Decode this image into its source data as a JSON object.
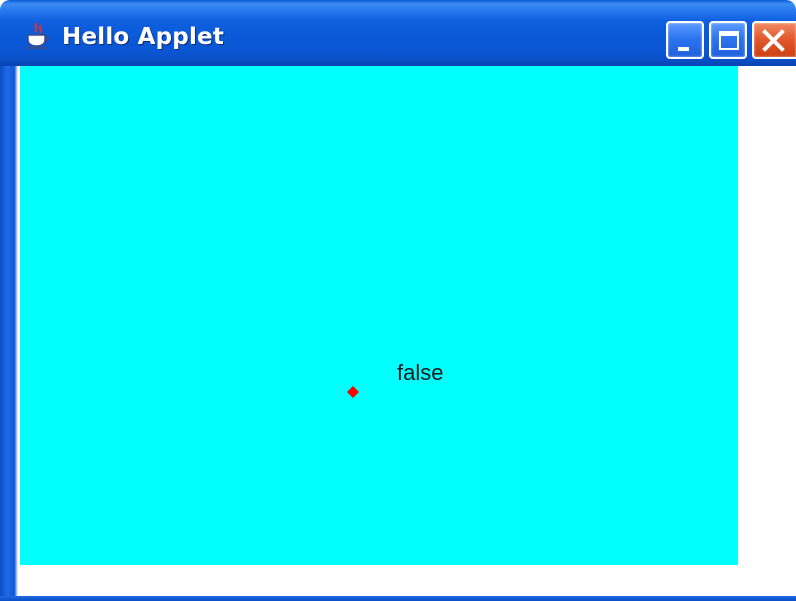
{
  "window": {
    "title": "Hello Applet",
    "icon": "java-coffee-cup-icon",
    "controls": {
      "minimize": "minimize-icon",
      "maximize": "maximize-icon",
      "close": "close-icon"
    }
  },
  "applet": {
    "background_color": "#00FFFF",
    "dot_color": "#FF0000",
    "status_text": "false"
  }
}
